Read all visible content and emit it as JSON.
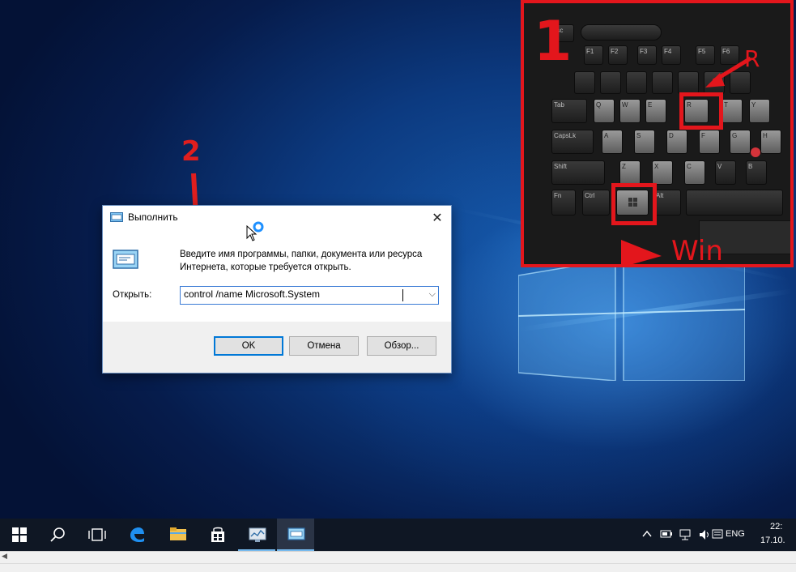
{
  "run_dialog": {
    "title": "Выполнить",
    "close": "✕",
    "description": "Введите имя программы, папки, документа или ресурса Интернета, которые требуется открыть.",
    "open_label": "Открыть:",
    "open_value": "control /name Microsoft.System",
    "dropdown": "⌵",
    "ok": "OK",
    "cancel": "Отмена",
    "browse": "Обзор..."
  },
  "annotations": {
    "step1": "1",
    "step2": "2",
    "key_r": "R",
    "key_win": "Win"
  },
  "keyboard": {
    "row0": [
      "Esc"
    ],
    "row1": [
      "F1",
      "F2",
      "F3",
      "F4",
      "F5",
      "F6"
    ],
    "row3": [
      "Tab",
      "Q",
      "W",
      "E",
      "R",
      "T",
      "Y"
    ],
    "row4": [
      "CapsLk",
      "A",
      "S",
      "D",
      "F",
      "G",
      "H"
    ],
    "row5": [
      "Shift",
      "Z",
      "X",
      "C",
      "V",
      "B"
    ],
    "row6": [
      "Fn",
      "Ctrl",
      "",
      "Alt"
    ]
  },
  "taskbar": {
    "icons": [
      "windows-start-icon",
      "search-icon",
      "task-view-icon",
      "edge-icon",
      "file-explorer-icon",
      "store-icon",
      "system-monitor-icon",
      "run-app-icon"
    ]
  },
  "tray": {
    "language": "ENG",
    "time": "22:",
    "date": "17.10."
  },
  "colors": {
    "annotation_red": "#e3161c",
    "accent_blue": "#0078d7",
    "taskbar_bg": "#0f1724"
  }
}
